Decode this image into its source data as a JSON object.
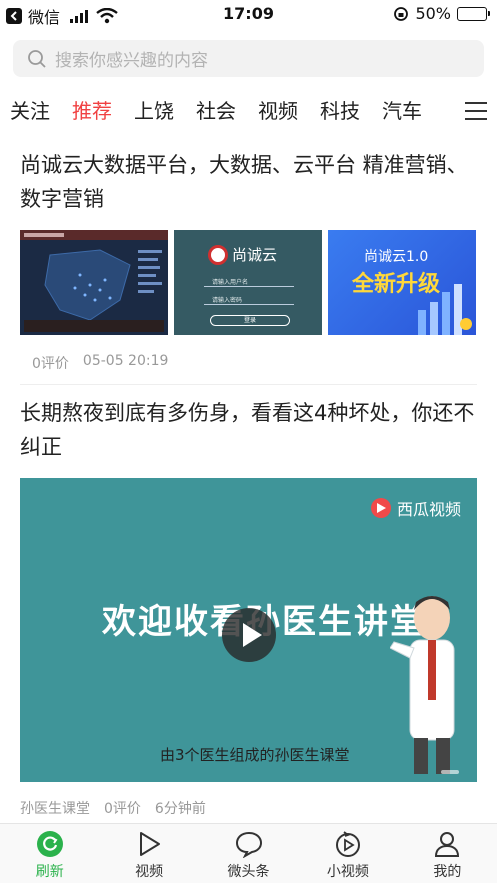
{
  "status_bar": {
    "carrier": "微信",
    "time": "17:09",
    "battery": "50%"
  },
  "search": {
    "placeholder": "搜索你感兴趣的内容"
  },
  "tabs": [
    "关注",
    "推荐",
    "上饶",
    "社会",
    "视频",
    "科技",
    "汽车"
  ],
  "active_tab": "推荐",
  "colors": {
    "accent": "#f04142",
    "nav_active": "#2bb24c",
    "video_bg": "#3f9599"
  },
  "articles": [
    {
      "title": "尚诚云大数据平台，大数据、云平台 精准营销、数字营销",
      "thumb_texts": {
        "thumb2_brand": "尚诚云",
        "thumb2_user": "请输入用户名",
        "thumb2_pass": "请输入密码",
        "thumb2_btn": "登录",
        "thumb3_line1": "尚诚云1.0",
        "thumb3_line2": "全新升级"
      },
      "comments": "0评价",
      "time": "05-05 20:19"
    },
    {
      "title": "长期熬夜到底有多伤身，看看这4种坏处，你还不纠正",
      "video": {
        "logo": "西瓜视频",
        "headline": "欢迎收看孙医生讲堂",
        "subtitle": "由3个医生组成的孙医生课堂"
      },
      "source": "孙医生课堂",
      "comments": "0评价",
      "time": "6分钟前"
    }
  ],
  "bottom_nav": [
    {
      "label": "刷新",
      "icon": "refresh-icon",
      "active": true
    },
    {
      "label": "视频",
      "icon": "video-play-icon",
      "active": false
    },
    {
      "label": "微头条",
      "icon": "chat-bubble-icon",
      "active": false
    },
    {
      "label": "小视频",
      "icon": "short-video-icon",
      "active": false
    },
    {
      "label": "我的",
      "icon": "profile-icon",
      "active": false
    }
  ]
}
